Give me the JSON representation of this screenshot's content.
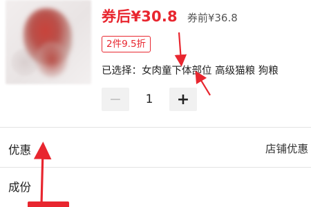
{
  "product": {
    "image_alt": "blurred product image",
    "price_after_coupon": "券后¥30.8",
    "price_before_coupon": "券前¥36.8",
    "discount_badge": "2件9.5折",
    "selected_text": "已选择：女肉童下体部位 高级猫粮 狗粮"
  },
  "quantity": {
    "minus_label": "−",
    "value": "1",
    "plus_label": "+"
  },
  "sections": {
    "discount_label": "优惠",
    "discount_right": "店铺优惠",
    "ingredients_label": "成份"
  },
  "colors": {
    "accent": "#e8262f",
    "annotation_arrow": "#e8262f"
  }
}
